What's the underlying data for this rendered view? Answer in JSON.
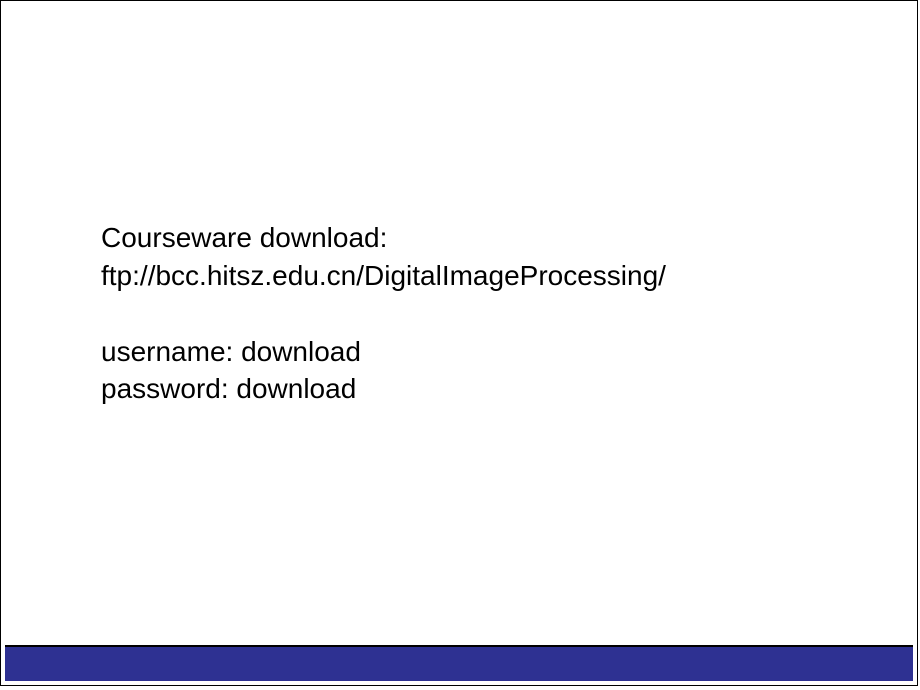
{
  "slide": {
    "line1": "Courseware download:",
    "line2": "ftp://bcc.hitsz.edu.cn/DigitalImageProcessing/",
    "line3": "username: download",
    "line4": "password: download"
  }
}
